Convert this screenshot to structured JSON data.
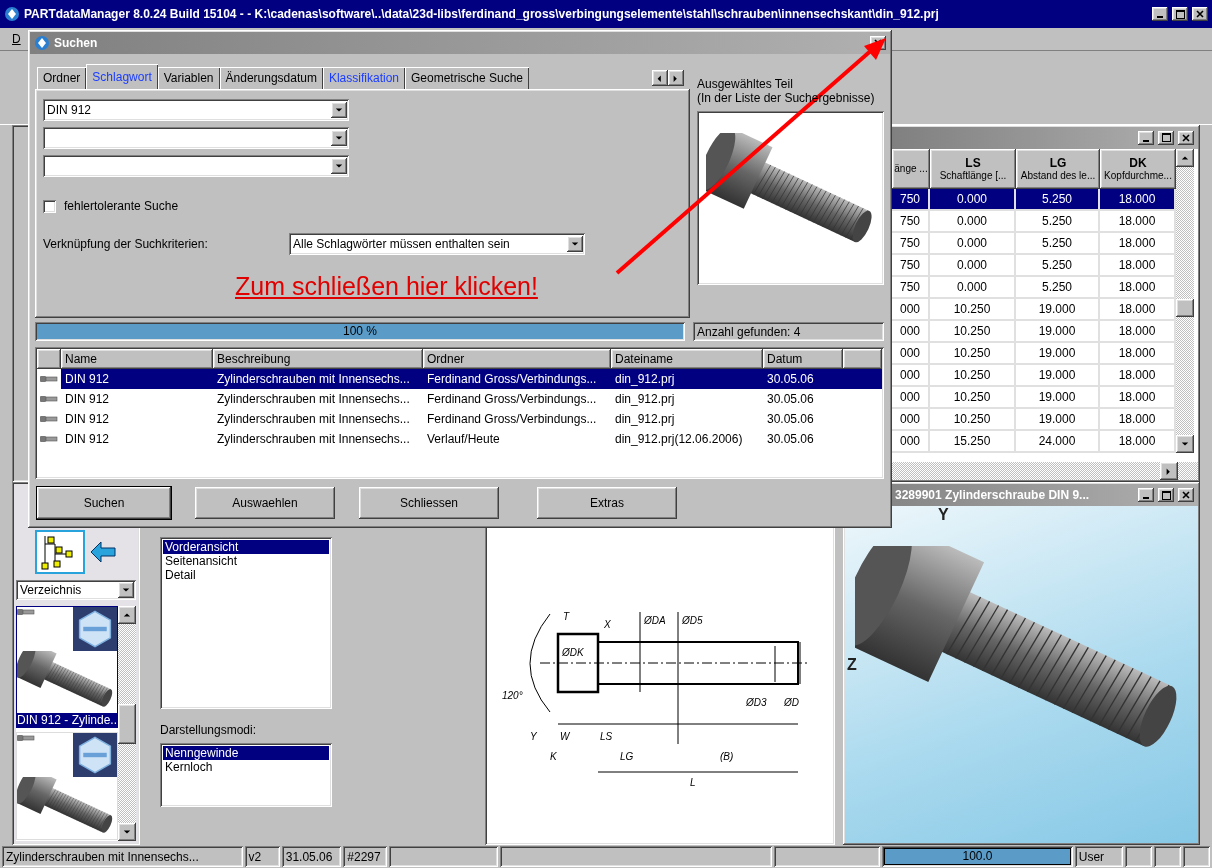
{
  "app": {
    "title": "PARTdataManager 8.0.24 Build 15104 -  - K:\\cadenas\\software\\..\\data\\23d-libs\\ferdinand_gross\\verbingungselemente\\stahl\\schrauben\\innensechskant\\din_912.prj",
    "menu": [
      "D"
    ]
  },
  "table_window": {
    "columns": [
      {
        "label": "änge ..."
      },
      {
        "code": "LS",
        "label": "Schaftlänge [..."
      },
      {
        "code": "LG",
        "label": "Abstand des le..."
      },
      {
        "code": "DK",
        "label": "Kopfdurchme..."
      }
    ],
    "rows": [
      {
        "cells": [
          "750",
          "0.000",
          "5.250",
          "18.000"
        ],
        "selected": true
      },
      {
        "cells": [
          "750",
          "0.000",
          "5.250",
          "18.000"
        ],
        "selected": false
      },
      {
        "cells": [
          "750",
          "0.000",
          "5.250",
          "18.000"
        ],
        "selected": false
      },
      {
        "cells": [
          "750",
          "0.000",
          "5.250",
          "18.000"
        ],
        "selected": false
      },
      {
        "cells": [
          "750",
          "0.000",
          "5.250",
          "18.000"
        ],
        "selected": false
      },
      {
        "cells": [
          "000",
          "10.250",
          "19.000",
          "18.000"
        ],
        "selected": false
      },
      {
        "cells": [
          "000",
          "10.250",
          "19.000",
          "18.000"
        ],
        "selected": false
      },
      {
        "cells": [
          "000",
          "10.250",
          "19.000",
          "18.000"
        ],
        "selected": false
      },
      {
        "cells": [
          "000",
          "10.250",
          "19.000",
          "18.000"
        ],
        "selected": false
      },
      {
        "cells": [
          "000",
          "10.250",
          "19.000",
          "18.000"
        ],
        "selected": false
      },
      {
        "cells": [
          "000",
          "10.250",
          "19.000",
          "18.000"
        ],
        "selected": false
      },
      {
        "cells": [
          "000",
          "15.250",
          "24.000",
          "18.000"
        ],
        "selected": false
      }
    ]
  },
  "navigator": {
    "combo": "Verzeichnis",
    "thumbnails": [
      {
        "caption": "DIN 912 - Zylinde...",
        "selected": true
      },
      {
        "selected": false
      }
    ]
  },
  "views": {
    "items": [
      {
        "label": "Vorderansicht",
        "selected": true
      },
      {
        "label": "Seitenansicht",
        "selected": false
      },
      {
        "label": "Detail",
        "selected": false
      }
    ],
    "modes_label": "Darstellungsmodi:",
    "modes": [
      {
        "label": "Nenngewinde",
        "selected": true
      },
      {
        "label": "Kernloch",
        "selected": false
      }
    ]
  },
  "drawing": {
    "dimension_labels": [
      "T",
      "X",
      "ØDA",
      "ØD5",
      "120°",
      "ØDK",
      "ØD3",
      "ØD",
      "Y",
      "W",
      "LS",
      "K",
      "LG",
      "(B)",
      "L"
    ]
  },
  "viewer_3d": {
    "title": "3289901 Zylinderschraube DIN 9...",
    "axes": [
      "Y",
      "Z"
    ]
  },
  "status_bar": {
    "cells": [
      "Zylinderschrauben mit Innensechs...",
      "v2",
      "31.05.06",
      "#2297"
    ],
    "progress": {
      "level": 1,
      "reading": "100.0"
    },
    "user": "User"
  },
  "dialog": {
    "title": "Suchen",
    "tabs": [
      {
        "label": "Ordner",
        "selected": false,
        "highlighted": false
      },
      {
        "label": "Schlagwort",
        "selected": true,
        "highlighted": true
      },
      {
        "label": "Variablen",
        "selected": false,
        "highlighted": false
      },
      {
        "label": "Änderungsdatum",
        "selected": false,
        "highlighted": false
      },
      {
        "label": "Klassifikation",
        "selected": false,
        "highlighted": true
      },
      {
        "label": "Geometrische Suche",
        "selected": false,
        "highlighted": false
      }
    ],
    "keyword_fields": [
      "DIN 912"
    ],
    "tolerant_search": {
      "label": "fehlertolerante Suche",
      "checked": false
    },
    "criteria": {
      "label": "Verknüpfung der Suchkriterien:",
      "value": "Alle Schlagwörter müssen enthalten sein"
    },
    "preview": {
      "heading": "Ausgewähltes Teil",
      "subheading": "(In der Liste der Suchergebnisse)"
    },
    "progress": {
      "level": 1,
      "reading": "100 %"
    },
    "found": "Anzahl gefunden: 4",
    "results": {
      "columns": [
        "Name",
        "Beschreibung",
        "Ordner",
        "Dateiname",
        "Datum"
      ],
      "rows": [
        {
          "cells": [
            "DIN 912",
            "Zylinderschrauben mit Innensechs...",
            "Ferdinand Gross/Verbindungs...",
            "din_912.prj",
            "30.05.06"
          ],
          "selected": true
        },
        {
          "cells": [
            "DIN 912",
            "Zylinderschrauben mit Innensechs...",
            "Ferdinand Gross/Verbindungs...",
            "din_912.prj",
            "30.05.06"
          ],
          "selected": false
        },
        {
          "cells": [
            "DIN 912",
            "Zylinderschrauben mit Innensechs...",
            "Ferdinand Gross/Verbindungs...",
            "din_912.prj",
            "30.05.06"
          ],
          "selected": false
        },
        {
          "cells": [
            "DIN 912",
            "Zylinderschrauben mit Innensechs...",
            "Verlauf/Heute",
            "din_912.prj(12.06.2006)",
            "30.05.06"
          ],
          "selected": false
        }
      ]
    },
    "buttons": [
      {
        "label": "Suchen",
        "default": true
      },
      {
        "label": "Auswaehlen",
        "default": false
      },
      {
        "label": "Schliessen",
        "default": false
      },
      {
        "label": "Extras",
        "default": false
      }
    ],
    "annotation": "Zum schließen hier klicken!"
  }
}
